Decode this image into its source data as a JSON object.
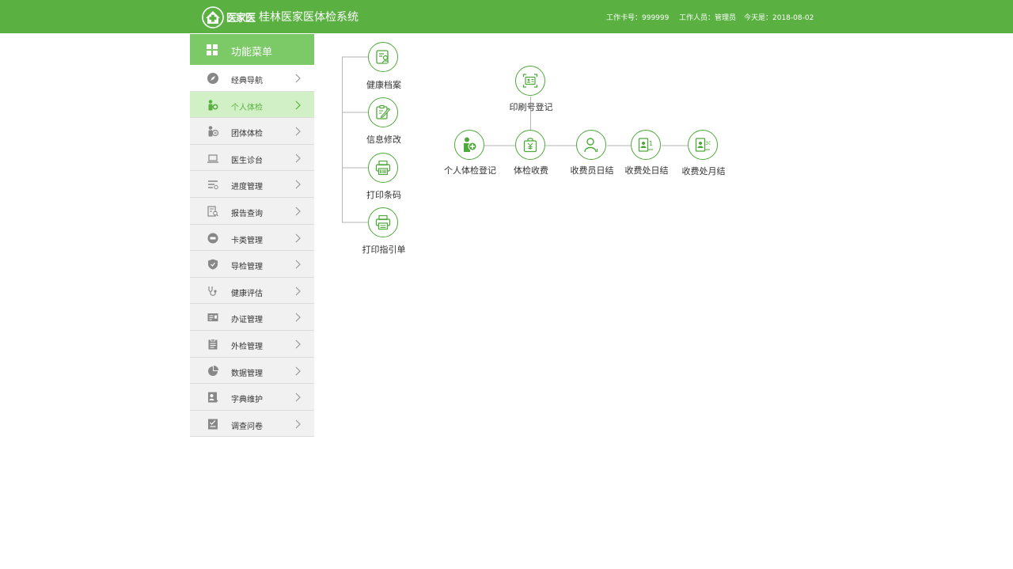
{
  "header": {
    "brand": "医家医",
    "title": "桂林医家医体检系统",
    "card_no": "工作卡号：999999",
    "staff": "工作人员：管理员",
    "date": "今天是：2018-08-02"
  },
  "sidebar": {
    "heading": "功能菜单",
    "items": [
      {
        "label": "经典导航",
        "icon": "compass-icon"
      },
      {
        "label": "个人体检",
        "icon": "person-add-icon"
      },
      {
        "label": "团体体检",
        "icon": "group-icon"
      },
      {
        "label": "医生诊台",
        "icon": "laptop-icon"
      },
      {
        "label": "进度管理",
        "icon": "progress-icon"
      },
      {
        "label": "报告查询",
        "icon": "report-search-icon"
      },
      {
        "label": "卡类管理",
        "icon": "card-icon"
      },
      {
        "label": "导检管理",
        "icon": "shield-icon"
      },
      {
        "label": "健康评估",
        "icon": "stethoscope-icon"
      },
      {
        "label": "办证管理",
        "icon": "certificate-icon"
      },
      {
        "label": "外检管理",
        "icon": "clipboard-icon"
      },
      {
        "label": "数据管理",
        "icon": "pie-chart-icon"
      },
      {
        "label": "字典维护",
        "icon": "dictionary-icon"
      },
      {
        "label": "调查问卷",
        "icon": "survey-icon"
      }
    ]
  },
  "flow": {
    "left_branch": [
      {
        "label": "健康档案",
        "icon": "health-file-icon"
      },
      {
        "label": "信息修改",
        "icon": "edit-icon"
      },
      {
        "label": "打印条码",
        "icon": "barcode-printer-icon"
      },
      {
        "label": "打印指引单",
        "icon": "printer-icon"
      }
    ],
    "print_no": {
      "label": "印刷号登记",
      "icon": "id-card-icon"
    },
    "main": [
      {
        "label": "个人体检登记",
        "icon": "person-add-icon"
      },
      {
        "label": "体检收费",
        "icon": "yuan-bag-icon"
      },
      {
        "label": "收费员日结",
        "icon": "cashier-icon"
      },
      {
        "label": "收费处日结",
        "icon": "daily-settle-icon",
        "badge": "1"
      },
      {
        "label": "收费处月结",
        "icon": "monthly-settle-icon",
        "badge": "30"
      }
    ]
  },
  "colors": {
    "brand_green": "#5ab142",
    "active_bg": "#d2f0c5",
    "menu_head": "#7bc967"
  }
}
